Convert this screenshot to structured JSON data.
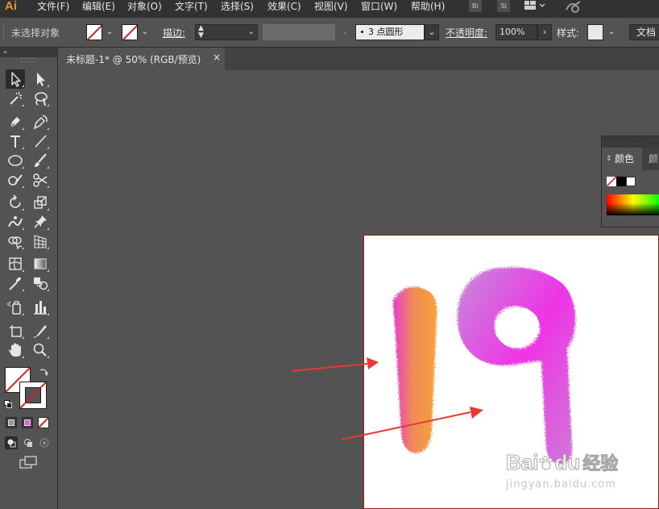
{
  "app": {
    "logo": "Ai"
  },
  "menu": [
    "文件(F)",
    "编辑(E)",
    "对象(O)",
    "文字(T)",
    "选择(S)",
    "效果(C)",
    "视图(V)",
    "窗口(W)",
    "帮助(H)"
  ],
  "appbar": {
    "br": "Br",
    "st": "St"
  },
  "control": {
    "selection_status": "未选择对象",
    "stroke_label": "描边:",
    "brush_value": "3 点圆形",
    "opacity_label": "不透明度:",
    "opacity_value": "100%",
    "style_label": "样式:",
    "document_label": "文档"
  },
  "document": {
    "tab_title": "未标题-1* @ 50% (RGB/预览)",
    "close_glyph": "×"
  },
  "color_panel": {
    "tab_active": "颜色",
    "tab_next": "颜"
  },
  "watermark": {
    "brand": "Bai",
    "brand_tail": "du",
    "jingyan": "经验",
    "url": "jingyan.baidu.com"
  },
  "artwork": {
    "text": "19",
    "digit_one_colors": [
      "#f7a23a",
      "#e73bd3"
    ],
    "digit_nine_colors": [
      "#d07ad8",
      "#ee34e6"
    ],
    "arrow_color": "#e83a34"
  },
  "tools": [
    "selection-tool",
    "direct-selection-tool",
    "magic-wand-tool",
    "lasso-tool",
    "pen-tool",
    "curvature-tool",
    "type-tool",
    "line-tool",
    "ellipse-tool",
    "paintbrush-tool",
    "shaper-tool",
    "scissors-tool",
    "rotate-tool",
    "scale-tool",
    "puppet-warp-tool",
    "pin-tool",
    "shape-builder-tool",
    "perspective-grid-tool",
    "mesh-tool",
    "gradient-tool",
    "eyedropper-tool",
    "blend-tool",
    "symbol-sprayer-tool",
    "column-graph-tool",
    "artboard-tool",
    "slice-tool",
    "hand-tool",
    "zoom-tool"
  ]
}
